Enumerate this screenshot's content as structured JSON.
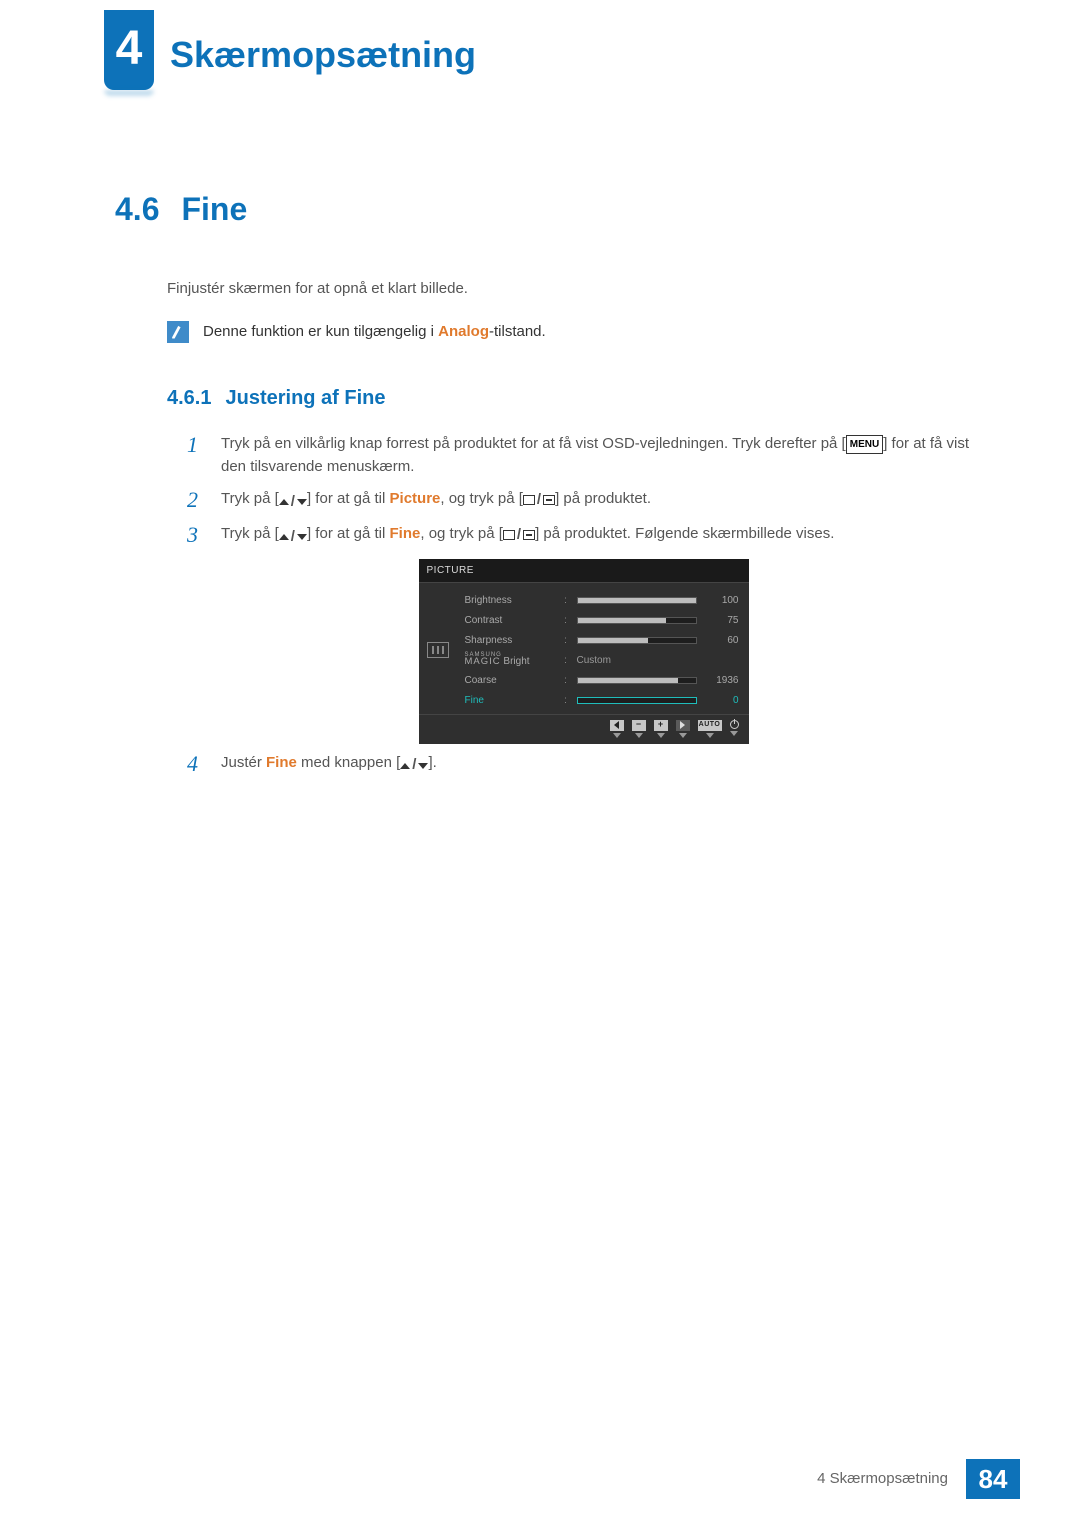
{
  "chapter": {
    "number": "4",
    "title": "Skærmopsætning"
  },
  "section": {
    "number": "4.6",
    "title": "Fine"
  },
  "intro": "Finjustér skærmen for at opnå et klart billede.",
  "note": {
    "pre": "Denne funktion er kun tilgængelig i ",
    "highlight": "Analog",
    "post": "-tilstand."
  },
  "subsection": {
    "number": "4.6.1",
    "title": "Justering af Fine"
  },
  "steps": {
    "s1": {
      "n": "1",
      "a": "Tryk på en vilkårlig knap forrest på produktet for at få vist OSD-vejledningen. Tryk derefter på [",
      "b": "] for at få vist den tilsvarende menuskærm.",
      "menu": "MENU"
    },
    "s2": {
      "n": "2",
      "a": "Tryk på [",
      "b": "] for at gå til ",
      "hl": "Picture",
      "c": ", og tryk på [",
      "d": "] på produktet."
    },
    "s3": {
      "n": "3",
      "a": "Tryk på [",
      "b": "] for at gå til ",
      "hl": "Fine",
      "c": ", og tryk på [",
      "d": "] på produktet. Følgende skærmbillede vises."
    },
    "s4": {
      "n": "4",
      "a": "Justér ",
      "hl": "Fine",
      "b": " med knappen [",
      "c": "]."
    }
  },
  "osd": {
    "title": "PICTURE",
    "magic_top": "SAMSUNG",
    "magic_bottom": "MAGIC",
    "magic_suffix": " Bright",
    "rows": [
      {
        "label": "Brightness",
        "value": 100,
        "max": 100,
        "type": "bar"
      },
      {
        "label": "Contrast",
        "value": 75,
        "max": 100,
        "type": "bar"
      },
      {
        "label": "Sharpness",
        "value": 60,
        "max": 100,
        "type": "bar"
      },
      {
        "label": "MAGIC Bright",
        "text": "Custom",
        "type": "text"
      },
      {
        "label": "Coarse",
        "value": 1936,
        "fill_pct": 85,
        "type": "bar"
      },
      {
        "label": "Fine",
        "value": 0,
        "fill_pct": 0,
        "type": "bar",
        "selected": true
      }
    ],
    "bottom_auto": "AUTO"
  },
  "footer": {
    "text": "4 Skærmopsætning",
    "page": "84"
  }
}
